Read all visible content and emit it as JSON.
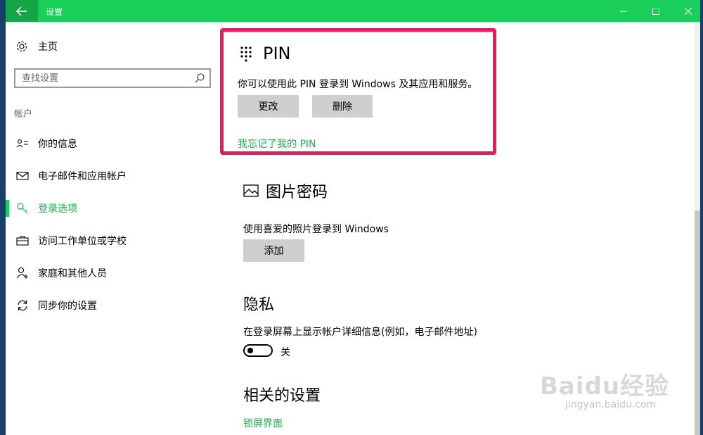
{
  "window": {
    "back_icon": "arrow-left-icon",
    "title": "设置",
    "controls": [
      "minimize-icon",
      "maximize-icon",
      "close-icon"
    ]
  },
  "sidebar": {
    "home_label": "主页",
    "home_icon": "gear-icon",
    "search_placeholder": "查找设置",
    "search_icon": "search-icon",
    "section_label": "帐户",
    "items": [
      {
        "label": "你的信息",
        "icon": "person-card-icon",
        "active": false
      },
      {
        "label": "电子邮件和应用帐户",
        "icon": "mail-icon",
        "active": false
      },
      {
        "label": "登录选项",
        "icon": "key-icon",
        "active": true
      },
      {
        "label": "访问工作单位或学校",
        "icon": "briefcase-icon",
        "active": false
      },
      {
        "label": "家庭和其他人员",
        "icon": "person-add-icon",
        "active": false
      },
      {
        "label": "同步你的设置",
        "icon": "sync-icon",
        "active": false
      }
    ]
  },
  "main": {
    "pin": {
      "icon": "keypad-icon",
      "title": "PIN",
      "description": "你可以使用此 PIN 登录到 Windows 及其应用和服务。",
      "change_label": "更改",
      "delete_label": "删除",
      "forgot_link": "我忘记了我的 PIN"
    },
    "picture_password": {
      "icon": "picture-icon",
      "title": "图片密码",
      "description": "使用喜爱的照片登录到 Windows",
      "add_label": "添加"
    },
    "privacy": {
      "title": "隐私",
      "description": "在登录屏幕上显示帐户详细信息(例如，电子邮件地址)",
      "toggle_state": "关"
    },
    "related": {
      "title": "相关的设置",
      "link": "锁屏界面"
    }
  },
  "watermark": {
    "brand": "Baidu经验",
    "url": "jingyan.baidu.com"
  },
  "colors": {
    "accent": "#19cf5a",
    "accent_text": "#14b54b",
    "highlight_frame": "#ee1862",
    "button_bg": "#cfcfcf"
  }
}
